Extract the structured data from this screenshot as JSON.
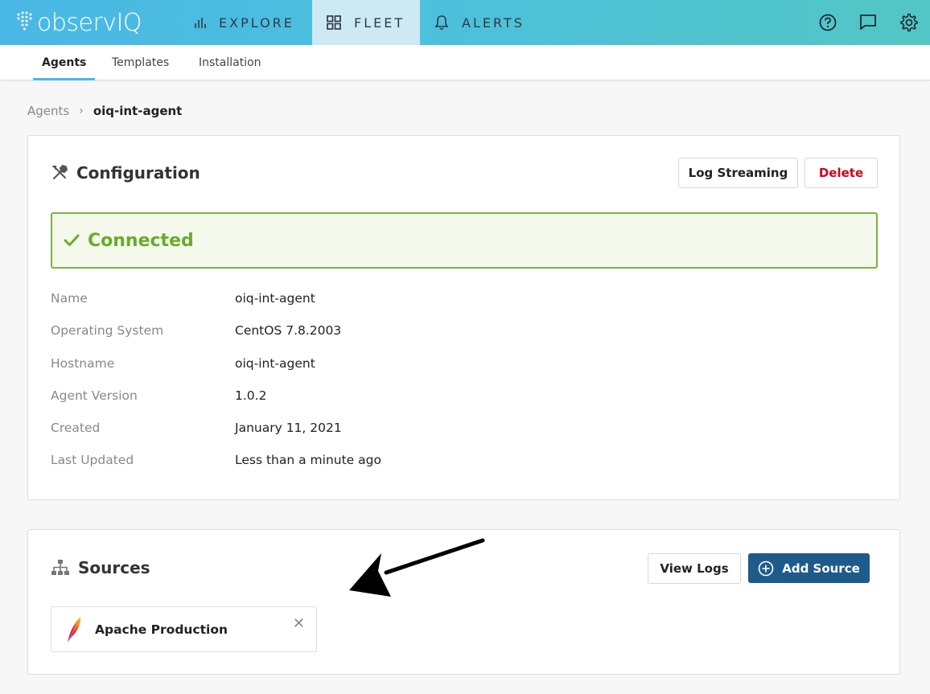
{
  "brand": {
    "logo_text": "observIQ"
  },
  "nav": {
    "explore": "EXPLORE",
    "fleet": "FLEET",
    "alerts": "ALERTS"
  },
  "subtabs": [
    "Agents",
    "Templates",
    "Installation"
  ],
  "breadcrumb": {
    "parent": "Agents",
    "separator": "›",
    "current": "oiq-int-agent"
  },
  "configuration": {
    "title": "Configuration",
    "log_streaming_label": "Log Streaming",
    "delete_label": "Delete",
    "status": "Connected",
    "fields": [
      {
        "label": "Name",
        "value": "oiq-int-agent"
      },
      {
        "label": "Operating System",
        "value": "CentOS 7.8.2003"
      },
      {
        "label": "Hostname",
        "value": "oiq-int-agent"
      },
      {
        "label": "Agent Version",
        "value": "1.0.2"
      },
      {
        "label": "Created",
        "value": "January 11, 2021"
      },
      {
        "label": "Last Updated",
        "value": "Less than a minute ago"
      }
    ]
  },
  "sources": {
    "title": "Sources",
    "view_logs_label": "View Logs",
    "add_source_label": "Add Source",
    "items": [
      {
        "name": "Apache Production",
        "remove": "✕"
      }
    ]
  },
  "colors": {
    "accent": "#4ab8e6",
    "primary_button": "#1e5b8c",
    "connected": "#6aaa2e",
    "delete": "#d0021b"
  }
}
